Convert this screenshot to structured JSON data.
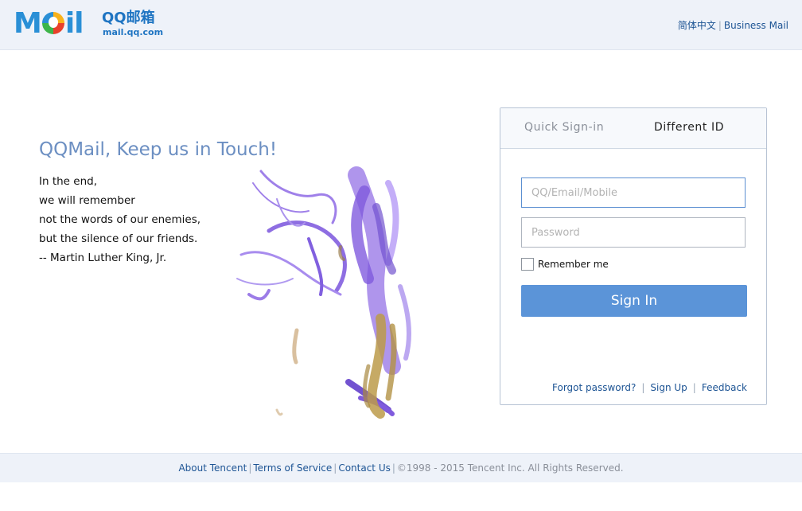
{
  "header": {
    "logo_text": "Mail",
    "brand_name": "QQ邮箱",
    "brand_url": "mail.qq.com",
    "lang_link": "简体中文",
    "business_link": "Business Mail",
    "separator": "|"
  },
  "promo": {
    "slogan": "QQMail, Keep us in Touch!",
    "quote_lines": [
      "In the end,",
      "we will remember",
      "not the words of our enemies,",
      "but the silence of our friends.",
      "-- Martin Luther King, Jr."
    ]
  },
  "login": {
    "tabs": [
      "Quick Sign-in",
      "Different ID"
    ],
    "active_tab": "Different ID",
    "username_placeholder": "QQ/Email/Mobile",
    "username_value": "",
    "password_placeholder": "Password",
    "password_value": "",
    "remember_label": "Remember me",
    "remember_checked": false,
    "signin_label": "Sign In",
    "links": [
      "Forgot password?",
      "Sign Up",
      "Feedback"
    ]
  },
  "footer": {
    "links": [
      "About Tencent",
      "Terms of Service",
      "Contact Us"
    ],
    "copyright": "©1998 - 2015 Tencent Inc. All Rights Reserved."
  },
  "colors": {
    "accent": "#5b94d8",
    "link": "#1d5494",
    "slogan": "#6c8fc2",
    "bar_bg": "#eef2f9"
  }
}
